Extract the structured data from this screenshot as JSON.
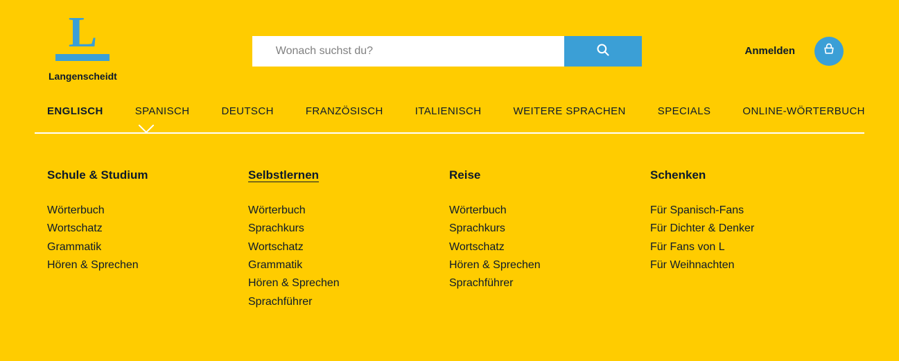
{
  "brand": "Langenscheidt",
  "search": {
    "placeholder": "Wonach suchst du?"
  },
  "login": "Anmelden",
  "nav": [
    "ENGLISCH",
    "SPANISCH",
    "DEUTSCH",
    "FRANZÖSISCH",
    "ITALIENISCH",
    "WEITERE SPRACHEN",
    "SPECIALS",
    "ONLINE-WÖRTERBUCH"
  ],
  "mega": {
    "col1": {
      "head": "Schule & Studium",
      "items": [
        "Wörterbuch",
        "Wortschatz",
        "Grammatik",
        "Hören & Sprechen"
      ]
    },
    "col2": {
      "head": "Selbstlernen",
      "items": [
        "Wörterbuch",
        "Sprachkurs",
        "Wortschatz",
        "Grammatik",
        "Hören & Sprechen",
        "Sprachführer"
      ]
    },
    "col3": {
      "head": "Reise",
      "items": [
        "Wörterbuch",
        "Sprachkurs",
        "Wortschatz",
        "Hören & Sprechen",
        "Sprachführer"
      ]
    },
    "col4": {
      "head": "Schenken",
      "items": [
        "Für Spanisch-Fans",
        "Für Dichter & Denker",
        "Für Fans von L",
        "Für Weihnachten"
      ]
    }
  }
}
